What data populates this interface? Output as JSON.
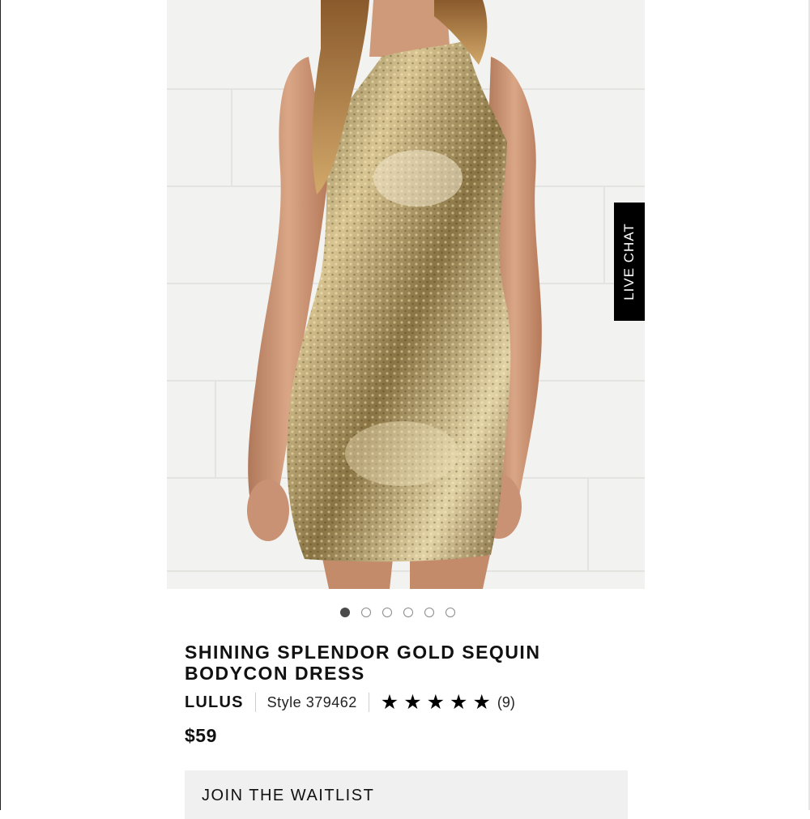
{
  "product": {
    "title": "SHINING SPLENDOR GOLD SEQUIN BODYCON DRESS",
    "brand": "LULUS",
    "style": "Style 379462",
    "rating": 5,
    "review_count": "(9)",
    "price": "$59"
  },
  "gallery": {
    "image_subject": "gold-sequin-dress-photo",
    "total_images": 6,
    "active_index": 0
  },
  "live_chat": {
    "label": "LIVE CHAT"
  },
  "actions": {
    "waitlist_label": "JOIN THE WAITLIST"
  },
  "icons": {
    "star": "star-icon"
  },
  "colors": {
    "text": "#111111",
    "live_chat_bg": "#000000",
    "button_bg": "#f0f0f0",
    "sequin_gold": "#b39a5c",
    "dot_active": "#4a4a4a"
  }
}
